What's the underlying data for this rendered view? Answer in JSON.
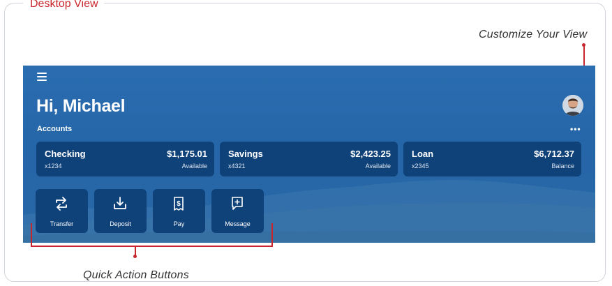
{
  "frame": {
    "title": "Desktop View"
  },
  "callouts": {
    "customize": "Customize Your View",
    "quick_actions": "Quick Action Buttons"
  },
  "header": {
    "greeting": "Hi, Michael",
    "accounts_label": "Accounts",
    "more_options": "•••",
    "menu_icon": "hamburger-menu-icon",
    "avatar_icon": "user-avatar"
  },
  "accounts": [
    {
      "name": "Checking",
      "number": "x1234",
      "amount": "$1,175.01",
      "amount_label": "Available"
    },
    {
      "name": "Savings",
      "number": "x4321",
      "amount": "$2,423.25",
      "amount_label": "Available"
    },
    {
      "name": "Loan",
      "number": "x2345",
      "amount": "$6,712.37",
      "amount_label": "Balance"
    }
  ],
  "quick_actions": [
    {
      "label": "Transfer",
      "icon": "transfer-icon"
    },
    {
      "label": "Deposit",
      "icon": "deposit-icon"
    },
    {
      "label": "Pay",
      "icon": "pay-icon"
    },
    {
      "label": "Message",
      "icon": "message-icon"
    }
  ],
  "colors": {
    "banner": "#2566a8",
    "card": "#10427a",
    "annotation": "#c8262c"
  }
}
